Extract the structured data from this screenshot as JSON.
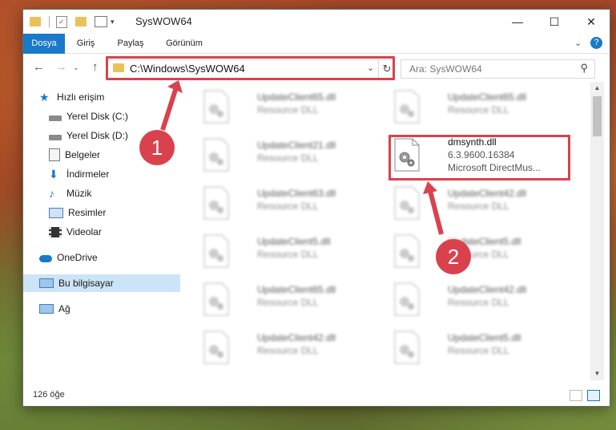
{
  "window": {
    "title": "SysWOW64",
    "controls": {
      "minimize": "—",
      "maximize": "☐",
      "close": "✕"
    }
  },
  "ribbon": {
    "tabs": [
      "Dosya",
      "Giriş",
      "Paylaş",
      "Görünüm"
    ],
    "help": "?"
  },
  "nav": {
    "path": "C:\\Windows\\SysWOW64",
    "search_placeholder": "Ara: SysWOW64"
  },
  "sidebar": {
    "items": [
      {
        "label": "Hızlı erişim",
        "icon": "star-icon"
      },
      {
        "label": "Yerel Disk (C:)",
        "icon": "drive-icon"
      },
      {
        "label": "Yerel Disk (D:)",
        "icon": "drive-icon"
      },
      {
        "label": "Belgeler",
        "icon": "documents-icon"
      },
      {
        "label": "İndirmeler",
        "icon": "download-icon"
      },
      {
        "label": "Müzik",
        "icon": "music-icon"
      },
      {
        "label": "Resimler",
        "icon": "pictures-icon"
      },
      {
        "label": "Videolar",
        "icon": "video-icon"
      },
      {
        "label": "OneDrive",
        "icon": "cloud-icon"
      },
      {
        "label": "Bu bilgisayar",
        "icon": "computer-icon"
      },
      {
        "label": "Ağ",
        "icon": "network-icon"
      }
    ]
  },
  "files": [
    {
      "name": "UpdateClient65.dll",
      "desc": "Resource DLL"
    },
    {
      "name": "UpdateClient65.dll",
      "desc": "Resource DLL"
    },
    {
      "name": "UpdateClient21.dll",
      "desc": "Resource DLL"
    },
    {
      "name": "dmsynth.dll",
      "version": "6.3.9600.16384",
      "desc": "Microsoft DirectMus..."
    },
    {
      "name": "UpdateClient63.dll",
      "desc": "Resource DLL"
    },
    {
      "name": "UpdateClient42.dll",
      "desc": "Resource DLL"
    },
    {
      "name": "UpdateClient5.dll",
      "desc": "Resource DLL"
    },
    {
      "name": "UpdateClient5.dll",
      "desc": "Resource DLL"
    },
    {
      "name": "UpdateClient65.dll",
      "desc": "Resource DLL"
    },
    {
      "name": "UpdateClient42.dll",
      "desc": "Resource DLL"
    },
    {
      "name": "UpdateClient42.dll",
      "desc": "Resource DLL"
    },
    {
      "name": "UpdateClient5.dll",
      "desc": "Resource DLL"
    }
  ],
  "status": {
    "count": "126 öğe"
  },
  "callouts": {
    "one": "1",
    "two": "2"
  },
  "colors": {
    "accent": "#1979ca",
    "highlight": "#d9424d",
    "selected": "#cce4f7"
  }
}
